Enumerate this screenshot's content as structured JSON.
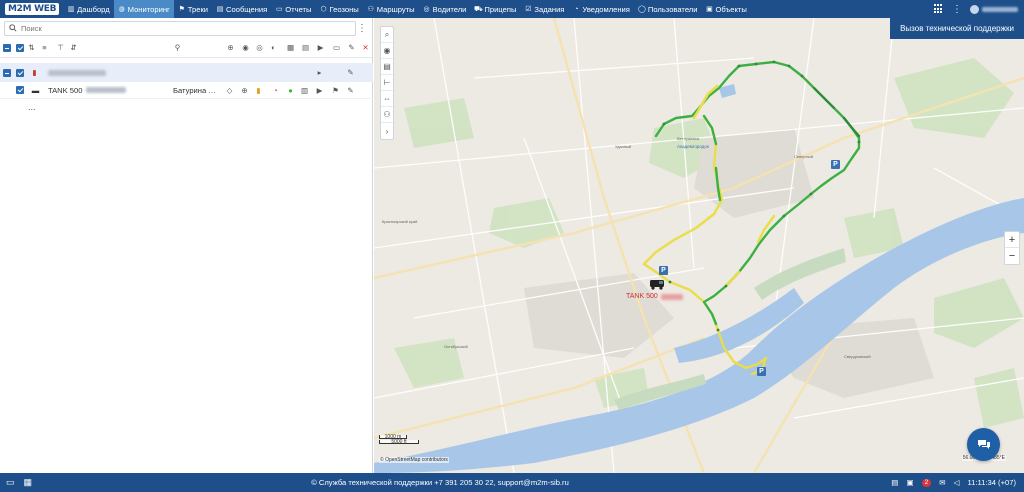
{
  "logo": "M2M WEB",
  "nav": [
    {
      "label": "Дашборд",
      "icon": "chart-icon",
      "glyph": "▥"
    },
    {
      "label": "Мониторинг",
      "icon": "globe-icon",
      "glyph": "◍",
      "active": true
    },
    {
      "label": "Треки",
      "icon": "flag-icon",
      "glyph": "⚑"
    },
    {
      "label": "Сообщения",
      "icon": "messages-icon",
      "glyph": "▤"
    },
    {
      "label": "Отчеты",
      "icon": "report-icon",
      "glyph": "▭"
    },
    {
      "label": "Геозоны",
      "icon": "geofence-icon",
      "glyph": "⬡"
    },
    {
      "label": "Маршруты",
      "icon": "route-icon",
      "glyph": "⚇"
    },
    {
      "label": "Водители",
      "icon": "steering-wheel-icon",
      "glyph": "◎"
    },
    {
      "label": "Прицепы",
      "icon": "trailer-icon",
      "glyph": "⛟"
    },
    {
      "label": "Задания",
      "icon": "tasks-icon",
      "glyph": "☑"
    },
    {
      "label": "Уведомления",
      "icon": "bell-icon",
      "glyph": "◔"
    },
    {
      "label": "Пользователи",
      "icon": "user-icon",
      "glyph": "◯"
    },
    {
      "label": "Объекты",
      "icon": "bus-icon",
      "glyph": "▣"
    }
  ],
  "support_tooltip": "Вызов технической поддержки",
  "search": {
    "placeholder": "Поиск"
  },
  "list": {
    "object_name": "TANK 500",
    "driver": "Батурина …",
    "more": "..."
  },
  "map": {
    "vehicle_label": "TANK 500",
    "parking": "P",
    "scale_top": "1000 m",
    "scale_bottom": "5000 ft",
    "attribution": "© OpenStreetMap contributors",
    "coords": "56.00…  93.3485°E",
    "zoom_in": "+",
    "zoom_out": "−"
  },
  "footer": {
    "support": "© Служба технической поддержки +7 391 205 30 22, support@m2m-sib.ru",
    "badge": "2",
    "time": "11:11:34 (+07)"
  },
  "colors": {
    "brand": "#1e4f8a",
    "active": "#4a8bc7",
    "track_green": "#3fbf3f",
    "track_yellow": "#e6e04a",
    "river": "#a8c6e8"
  }
}
